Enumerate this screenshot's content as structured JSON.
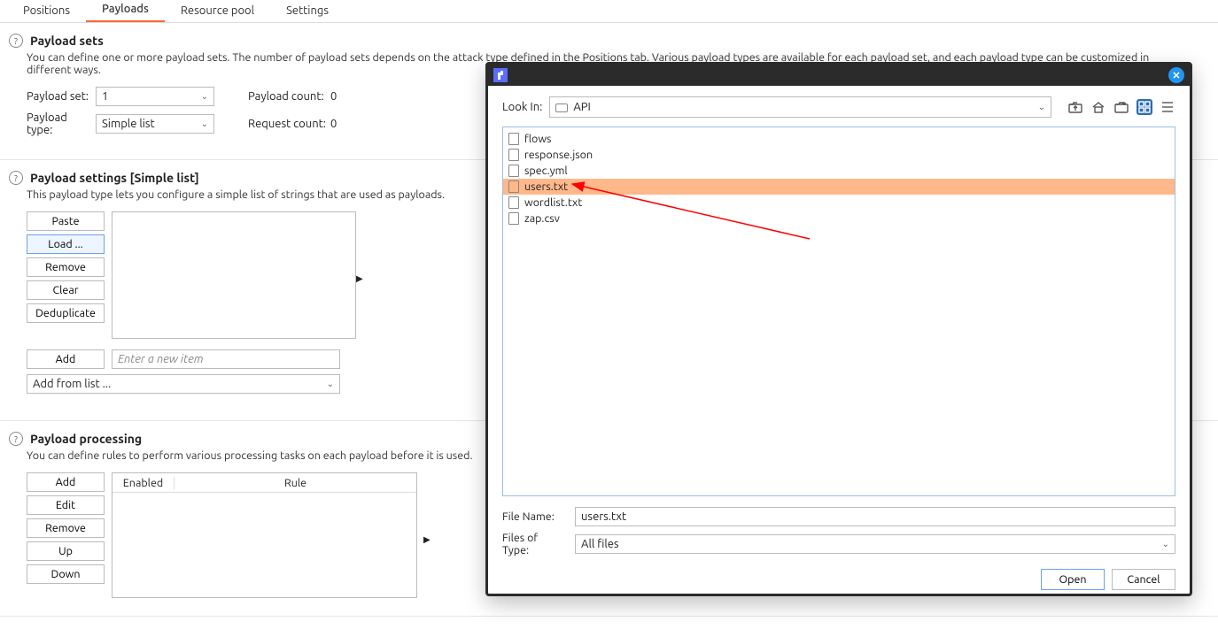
{
  "tabs": {
    "positions": "Positions",
    "payloads": "Payloads",
    "resource_pool": "Resource pool",
    "settings": "Settings"
  },
  "payload_sets": {
    "title": "Payload sets",
    "desc": "You can define one or more payload sets. The number of payload sets depends on the attack type defined in the Positions tab. Various payload types are available for each payload set, and each payload type can be customized in different ways.",
    "set_label": "Payload set:",
    "set_value": "1",
    "type_label": "Payload type:",
    "type_value": "Simple list",
    "count_label": "Payload count:",
    "count_value": "0",
    "req_label": "Request count:",
    "req_value": "0"
  },
  "payload_settings": {
    "title": "Payload settings [Simple list]",
    "desc": "This payload type lets you configure a simple list of strings that are used as payloads.",
    "btn_paste": "Paste",
    "btn_load": "Load ...",
    "btn_remove": "Remove",
    "btn_clear": "Clear",
    "btn_dedup": "Deduplicate",
    "btn_add": "Add",
    "new_item_placeholder": "Enter a new item",
    "add_from_list": "Add from list ..."
  },
  "payload_processing": {
    "title": "Payload processing",
    "desc": "You can define rules to perform various processing tasks on each payload before it is used.",
    "btn_add": "Add",
    "btn_edit": "Edit",
    "btn_remove": "Remove",
    "btn_up": "Up",
    "btn_down": "Down",
    "col_enabled": "Enabled",
    "col_rule": "Rule"
  },
  "dialog": {
    "lookin_label": "Look In:",
    "lookin_value": "API",
    "files": [
      {
        "name": "flows",
        "selected": false
      },
      {
        "name": "response.json",
        "selected": false
      },
      {
        "name": "spec.yml",
        "selected": false
      },
      {
        "name": "users.txt",
        "selected": true
      },
      {
        "name": "wordlist.txt",
        "selected": false
      },
      {
        "name": "zap.csv",
        "selected": false
      }
    ],
    "filename_label": "File Name:",
    "filename_value": "users.txt",
    "filetype_label": "Files of Type:",
    "filetype_value": "All files",
    "btn_open": "Open",
    "btn_cancel": "Cancel"
  }
}
